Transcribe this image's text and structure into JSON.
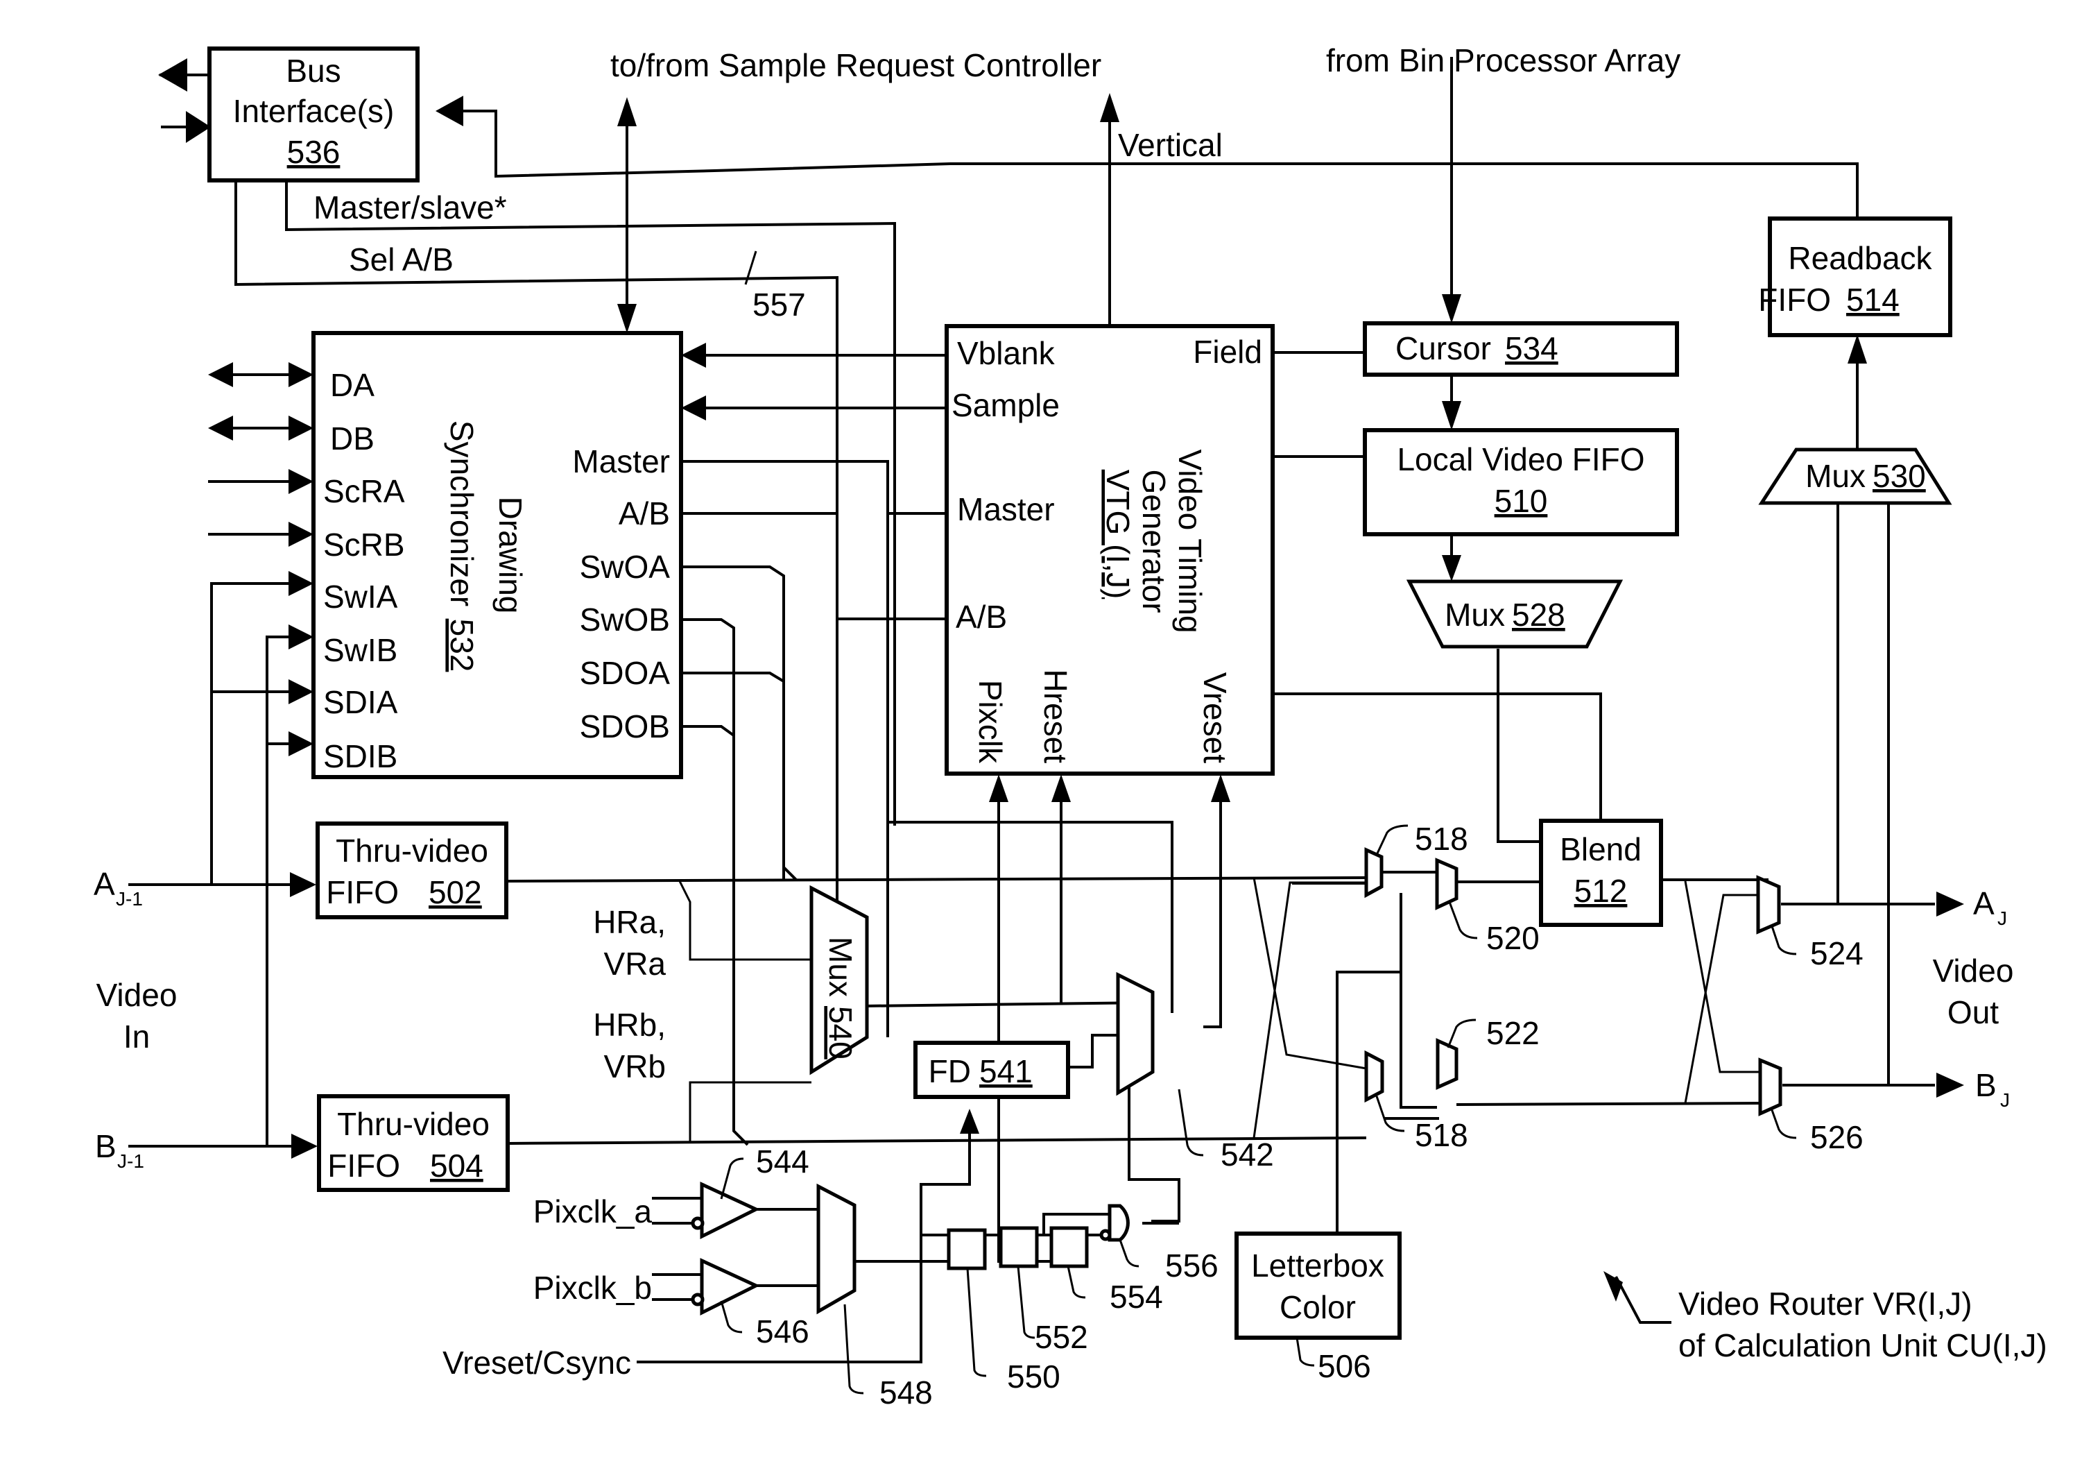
{
  "diagram": {
    "title": "Video Router VR(I,J) of Calculation Unit CU(I,J)",
    "caption": {
      "line1": "Video Router VR(I,J)",
      "line2": "of Calculation Unit CU(I,J)"
    },
    "external_labels": {
      "sample_request": "to/from Sample Request Controller",
      "bin_processor": "from Bin Processor Array",
      "vertical": "Vertical",
      "master_slave": "Master/slave*",
      "sel_ab": "Sel A/B",
      "ref_557": "557",
      "video_in_1": "Video",
      "video_in_2": "In",
      "video_out_1": "Video",
      "video_out_2": "Out",
      "a_in": "A",
      "a_in_sub": "J-1",
      "b_in": "B",
      "b_in_sub": "J-1",
      "a_out": "A",
      "a_out_sub": "J",
      "b_out": "B",
      "b_out_sub": "J",
      "hra": "HRa,",
      "vra": "VRa",
      "hrb": "HRb,",
      "vrb": "VRb",
      "pixclk_a": "Pixclk_a",
      "pixclk_b": "Pixclk_b",
      "vreset_csync": "Vreset/Csync"
    },
    "blocks": {
      "bus_interface": {
        "line1": "Bus",
        "line2": "Interface(s)",
        "ref": "536"
      },
      "drawing_sync": {
        "line1": "Drawing",
        "line2": "Synchronizer",
        "ref": "532",
        "left_ports": [
          "DA",
          "DB",
          "ScRA",
          "ScRB",
          "SwIA",
          "SwIB",
          "SDIA",
          "SDIB"
        ],
        "right_ports": [
          "Master",
          "A/B",
          "SwOA",
          "SwOB",
          "SDOA",
          "SDOB"
        ]
      },
      "vtg": {
        "line1": "Video Timing",
        "line2": "Generator",
        "ref": "VTG (I,J)",
        "left_ports": [
          "Vblank",
          "Sample",
          "Master",
          "A/B"
        ],
        "right_ports": [
          "Field"
        ],
        "bottom_ports": [
          "Pixclk",
          "Hreset",
          "Vreset"
        ]
      },
      "cursor": {
        "label": "Cursor",
        "ref": "534"
      },
      "local_video_fifo": {
        "label": "Local Video FIFO",
        "ref": "510"
      },
      "mux_528": {
        "label": "Mux",
        "ref": "528"
      },
      "readback_fifo": {
        "line1": "Readback",
        "line2": "FIFO",
        "ref": "514"
      },
      "mux_530": {
        "label": "Mux",
        "ref": "530"
      },
      "thru_fifo_a": {
        "line1": "Thru-video",
        "line2": "FIFO",
        "ref": "502"
      },
      "thru_fifo_b": {
        "line1": "Thru-video",
        "line2": "FIFO",
        "ref": "504"
      },
      "mux_540": {
        "label": "Mux",
        "ref": "540"
      },
      "fd_541": {
        "label": "FD",
        "ref": "541"
      },
      "blend": {
        "label": "Blend",
        "ref": "512"
      },
      "letterbox": {
        "line1": "Letterbox",
        "line2": "Color",
        "ref": "506"
      }
    },
    "ref_labels": {
      "mux_542": "542",
      "mux_518_top": "518",
      "mux_518_bottom": "518",
      "mux_520": "520",
      "mux_522": "522",
      "mux_524": "524",
      "mux_526": "526",
      "buf_544": "544",
      "buf_546": "546",
      "mux_548": "548",
      "ff_550": "550",
      "ff_552": "552",
      "ff_554": "554",
      "gate_556": "556"
    }
  }
}
